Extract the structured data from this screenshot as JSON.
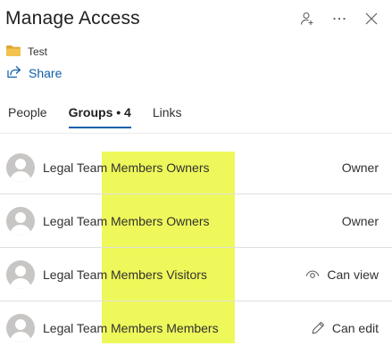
{
  "header": {
    "title": "Manage Access",
    "actions": [
      {
        "icon": "add-person-icon"
      },
      {
        "icon": "more-options-icon"
      },
      {
        "icon": "close-icon"
      }
    ]
  },
  "item": {
    "icon": "folder-icon",
    "name": "Test",
    "folder_color": "#f2c34e"
  },
  "share": {
    "icon": "share-icon",
    "label": "Share"
  },
  "tabs": [
    {
      "label": "People",
      "active": false
    },
    {
      "label": "Groups • 4",
      "active": true
    },
    {
      "label": "Links",
      "active": false
    }
  ],
  "groups": [
    {
      "name": "Legal Team Members Owners",
      "role": "Owner",
      "role_icon": ""
    },
    {
      "name": "Legal Team Members Owners",
      "role": "Owner",
      "role_icon": ""
    },
    {
      "name": "Legal Team Members Visitors",
      "role": "Can view",
      "role_icon": "eye-icon"
    },
    {
      "name": "Legal Team Members Members",
      "role": "Can edit",
      "role_icon": "pencil-icon"
    }
  ],
  "colors": {
    "accent": "#0f5fa8",
    "highlight": "#eef85a",
    "text": "#323130"
  }
}
